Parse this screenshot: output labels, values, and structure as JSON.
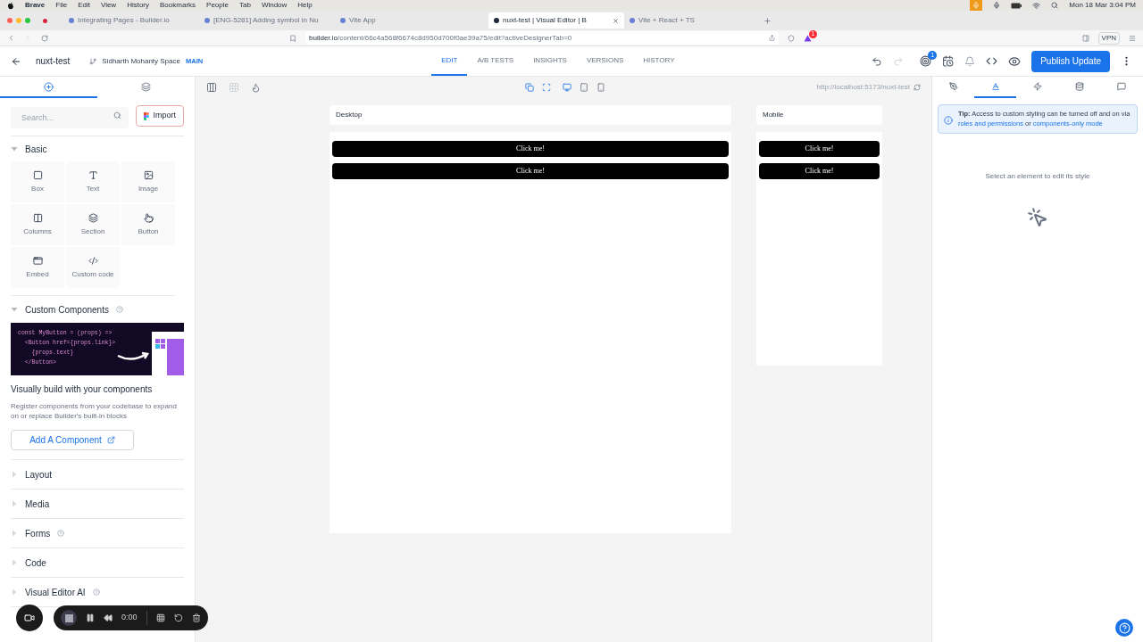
{
  "menubar": {
    "app": "Brave",
    "items": [
      "File",
      "Edit",
      "View",
      "History",
      "Bookmarks",
      "People",
      "Tab",
      "Window",
      "Help"
    ],
    "clock": "Mon 18 Mar 3:04 PM"
  },
  "browser_tabs": [
    {
      "title": "Integrating Pages - Builder.io",
      "selected": false
    },
    {
      "title": "[ENG-5281] Adding symbol in Nu",
      "selected": false
    },
    {
      "title": "Vite App",
      "selected": false
    },
    {
      "title": "nuxt-test | Visual Editor | B",
      "selected": true
    },
    {
      "title": "Vite + React + TS",
      "selected": false
    }
  ],
  "address_bar": {
    "domain": "builder.io",
    "path": "/content/66c4a568f6674c8d950d700f0ae39a75/edit?activeDesignerTab=0",
    "vpn": "VPN",
    "shield_badge": "1"
  },
  "header": {
    "title": "nuxt-test",
    "space": "Sidharth Mohanty Space",
    "branch": "MAIN",
    "tabs": [
      {
        "label": "EDIT",
        "selected": true
      },
      {
        "label": "A/B TESTS",
        "selected": false
      },
      {
        "label": "INSIGHTS",
        "selected": false
      },
      {
        "label": "VERSIONS",
        "selected": false
      },
      {
        "label": "HISTORY",
        "selected": false
      }
    ],
    "badge": "1",
    "publish": "Publish Update"
  },
  "left_panel": {
    "tabs": [
      {
        "selected": true
      },
      {
        "selected": false
      }
    ],
    "search": {
      "placeholder": "Search..."
    },
    "import": "Import",
    "basic": {
      "title": "Basic",
      "expanded": true,
      "blocks": [
        "Box",
        "Text",
        "Image",
        "Columns",
        "Section",
        "Button",
        "Embed",
        "Custom code"
      ]
    },
    "custom": {
      "title": "Custom Components",
      "expanded": true,
      "code_lines": [
        "const MyButton = (props) =>",
        "  <Button href={props.link}>",
        "    {props.text}",
        "  </Button>"
      ],
      "headline": "Visually build with your components",
      "description": "Register components from your codebase to expand on or replace Builder's built-in blocks",
      "button": "Add A Component"
    },
    "sections": [
      {
        "title": "Layout",
        "expanded": false,
        "help": false
      },
      {
        "title": "Media",
        "expanded": false,
        "help": false
      },
      {
        "title": "Forms",
        "expanded": false,
        "help": true
      },
      {
        "title": "Code",
        "expanded": false,
        "help": false
      },
      {
        "title": "Visual Editor AI",
        "expanded": false,
        "help": true
      }
    ]
  },
  "canvas": {
    "url": "http://localhost:5173/nuxt-test",
    "frames": [
      {
        "label": "Desktop",
        "kind": "desktop",
        "buttons": [
          "Click me!",
          "Click me!"
        ]
      },
      {
        "label": "Mobile",
        "kind": "mobile",
        "buttons": [
          "Click me!",
          "Click me!"
        ]
      }
    ]
  },
  "right_panel": {
    "tabs": [
      {
        "selected": false
      },
      {
        "selected": true
      },
      {
        "selected": false
      },
      {
        "selected": false
      },
      {
        "selected": false
      }
    ],
    "tip": {
      "label": "Tip:",
      "text": "Access to custom styling can be turned off and on via",
      "link1": "roles and permissions",
      "or": "or",
      "link2": "components-only mode"
    },
    "empty": "Select an element to edit its style"
  },
  "recorder": {
    "time": "0:00"
  }
}
